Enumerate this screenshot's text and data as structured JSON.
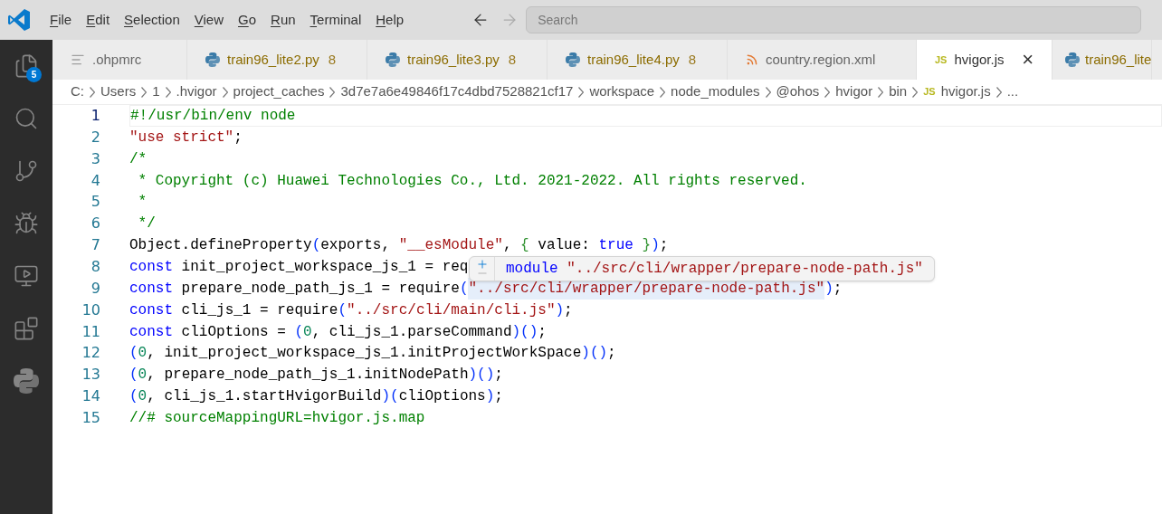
{
  "menu": [
    {
      "label": "File"
    },
    {
      "label": "Edit"
    },
    {
      "label": "Selection"
    },
    {
      "label": "View"
    },
    {
      "label": "Go"
    },
    {
      "label": "Run"
    },
    {
      "label": "Terminal"
    },
    {
      "label": "Help"
    }
  ],
  "search": {
    "placeholder": "Search"
  },
  "activity_bar": [
    {
      "kind": "files",
      "badge": "5"
    },
    {
      "kind": "search"
    },
    {
      "kind": "source-control"
    },
    {
      "kind": "debug"
    },
    {
      "kind": "remote"
    },
    {
      "kind": "extensions"
    },
    {
      "kind": "python"
    }
  ],
  "tabs": [
    {
      "label": ".ohpmrc",
      "kind": "file",
      "selected": false,
      "warning": false
    },
    {
      "label": "train96_lite2.py",
      "kind": "python",
      "badge": "8",
      "selected": false,
      "warning": true
    },
    {
      "label": "train96_lite3.py",
      "kind": "python",
      "badge": "8",
      "selected": false,
      "warning": true
    },
    {
      "label": "train96_lite4.py",
      "kind": "python",
      "badge": "8",
      "selected": false,
      "warning": true
    },
    {
      "label": "country.region.xml",
      "kind": "rss",
      "selected": false,
      "warning": false
    },
    {
      "label": "hvigor.js",
      "kind": "js",
      "icon_text": "JS",
      "selected": true,
      "warning": false,
      "close": "×"
    },
    {
      "label": "train96_lite",
      "kind": "python",
      "selected": false,
      "warning": true
    }
  ],
  "breadcrumb": [
    {
      "label": "C:"
    },
    {
      "label": "Users"
    },
    {
      "label": "1"
    },
    {
      "label": ".hvigor"
    },
    {
      "label": "project_caches"
    },
    {
      "label": "3d7e7a6e49846f17c4dbd7528821cf17"
    },
    {
      "label": "workspace"
    },
    {
      "label": "node_modules"
    },
    {
      "label": "@ohos"
    },
    {
      "label": "hvigor"
    },
    {
      "label": "bin"
    },
    {
      "label": "hvigor.js",
      "icon_text": "JS"
    },
    {
      "label": "..."
    }
  ],
  "editor": {
    "lines": [
      {
        "number": "1",
        "current": true,
        "tokens": [
          {
            "kind": "com",
            "text": "#!/usr/bin/env node"
          }
        ]
      },
      {
        "number": "2",
        "current": false,
        "tokens": [
          {
            "kind": "str",
            "text": "\"use strict\""
          },
          {
            "kind": "plain",
            "text": ";"
          }
        ]
      },
      {
        "number": "3",
        "current": false,
        "tokens": [
          {
            "kind": "com",
            "text": "/*"
          }
        ]
      },
      {
        "number": "4",
        "current": false,
        "tokens": [
          {
            "kind": "com",
            "text": " * Copyright (c) Huawei Technologies Co., Ltd. 2021-2022. All rights reserved."
          }
        ]
      },
      {
        "number": "5",
        "current": false,
        "tokens": [
          {
            "kind": "com",
            "text": " *"
          }
        ]
      },
      {
        "number": "6",
        "current": false,
        "tokens": [
          {
            "kind": "com",
            "text": " */"
          }
        ]
      },
      {
        "number": "7",
        "current": false,
        "tokens": [
          {
            "kind": "plain",
            "text": "Object.defineProperty"
          },
          {
            "kind": "paren",
            "text": "("
          },
          {
            "kind": "plain",
            "text": "exports, "
          },
          {
            "kind": "str",
            "text": "\"__esModule\""
          },
          {
            "kind": "plain",
            "text": ", "
          },
          {
            "kind": "brace",
            "text": "{"
          },
          {
            "kind": "plain",
            "text": " value: "
          },
          {
            "kind": "kw",
            "text": "true"
          },
          {
            "kind": "brace",
            "text": " }"
          },
          {
            "kind": "paren",
            "text": ")"
          },
          {
            "kind": "plain",
            "text": ";"
          }
        ]
      },
      {
        "number": "8",
        "current": false,
        "tokens": [
          {
            "kind": "kw",
            "text": "const"
          },
          {
            "kind": "plain",
            "text": " init_project_workspace_js_1 = req"
          }
        ]
      },
      {
        "number": "9",
        "current": false,
        "tokens": [
          {
            "kind": "kw",
            "text": "const"
          },
          {
            "kind": "plain",
            "text": " prepare_node_path_js_1 = require"
          },
          {
            "kind": "paren",
            "text": "("
          },
          {
            "kind": "str",
            "text": "\"../src/cli/wrapper/prepare-node-path.js\"",
            "highlight": true
          },
          {
            "kind": "paren",
            "text": ")"
          },
          {
            "kind": "plain",
            "text": ";"
          }
        ]
      },
      {
        "number": "10",
        "current": false,
        "tokens": [
          {
            "kind": "kw",
            "text": "const"
          },
          {
            "kind": "plain",
            "text": " cli_js_1 = require"
          },
          {
            "kind": "paren",
            "text": "("
          },
          {
            "kind": "str",
            "text": "\"../src/cli/main/cli.js\""
          },
          {
            "kind": "paren",
            "text": ")"
          },
          {
            "kind": "plain",
            "text": ";"
          }
        ]
      },
      {
        "number": "11",
        "current": false,
        "tokens": [
          {
            "kind": "kw",
            "text": "const"
          },
          {
            "kind": "plain",
            "text": " cliOptions = "
          },
          {
            "kind": "paren",
            "text": "("
          },
          {
            "kind": "num",
            "text": "0"
          },
          {
            "kind": "plain",
            "text": ", cli_js_1.parseCommand"
          },
          {
            "kind": "paren",
            "text": ")()"
          },
          {
            "kind": "plain",
            "text": ";"
          }
        ]
      },
      {
        "number": "12",
        "current": false,
        "tokens": [
          {
            "kind": "paren",
            "text": "("
          },
          {
            "kind": "num",
            "text": "0"
          },
          {
            "kind": "plain",
            "text": ", init_project_workspace_js_1.initProjectWorkSpace"
          },
          {
            "kind": "paren",
            "text": ")()"
          },
          {
            "kind": "plain",
            "text": ";"
          }
        ]
      },
      {
        "number": "13",
        "current": false,
        "tokens": [
          {
            "kind": "paren",
            "text": "("
          },
          {
            "kind": "num",
            "text": "0"
          },
          {
            "kind": "plain",
            "text": ", prepare_node_path_js_1.initNodePath"
          },
          {
            "kind": "paren",
            "text": ")()"
          },
          {
            "kind": "plain",
            "text": ";"
          }
        ]
      },
      {
        "number": "14",
        "current": false,
        "tokens": [
          {
            "kind": "paren",
            "text": "("
          },
          {
            "kind": "num",
            "text": "0"
          },
          {
            "kind": "plain",
            "text": ", cli_js_1.startHvigorBuild"
          },
          {
            "kind": "paren",
            "text": ")("
          },
          {
            "kind": "plain",
            "text": "cliOptions"
          },
          {
            "kind": "paren",
            "text": ")"
          },
          {
            "kind": "plain",
            "text": ";"
          }
        ]
      },
      {
        "number": "15",
        "current": false,
        "tokens": [
          {
            "kind": "com",
            "text": "//# sourceMappingURL=hvigor.js.map"
          }
        ]
      }
    ]
  },
  "hover": {
    "tokens": [
      {
        "kind": "kw",
        "text": "module"
      },
      {
        "kind": "str",
        "text": "\"../src/cli/wrapper/prepare-node-path.js\""
      }
    ]
  }
}
